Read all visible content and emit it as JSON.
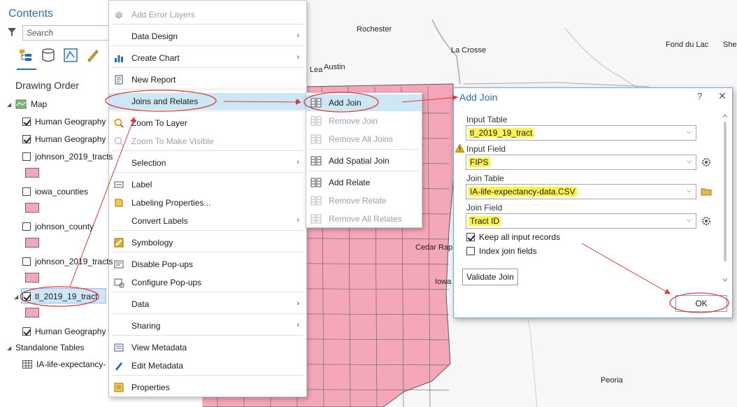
{
  "map": {
    "cities": [
      "Rochester",
      "La Crosse",
      "Fond du Lac",
      "She",
      "Austin",
      "Lea",
      "Cedar Rap",
      "Iowa",
      "Peoria"
    ],
    "county_fill": "#f4a7b9",
    "county_stroke": "#5a5a5a"
  },
  "contents": {
    "title": "Contents",
    "search_placeholder": "Search",
    "drawing_order_label": "Drawing Order",
    "map_label": "Map",
    "layers": [
      {
        "label": "Human Geography",
        "checked": true
      },
      {
        "label": "Human Geography",
        "checked": true
      },
      {
        "label": "johnson_2019_tracts",
        "checked": false
      },
      {
        "label": "iowa_counties",
        "checked": false
      },
      {
        "label": "johnson_county",
        "checked": false
      },
      {
        "label": "johnson_2019_tracts",
        "checked": false
      },
      {
        "label": "tl_2019_19_tract",
        "checked": true
      },
      {
        "label": "Human Geography",
        "checked": true
      }
    ],
    "standalone_label": "Standalone Tables",
    "table_label": "IA-life-expectancy-"
  },
  "context_menu": {
    "items": [
      {
        "label": "Add Error Layers",
        "disabled": true
      },
      {
        "label": "Data Design",
        "submenu": true
      },
      {
        "label": "Create Chart",
        "submenu": true
      },
      {
        "label": "New Report"
      },
      {
        "label": "Joins and Relates",
        "submenu": true
      },
      {
        "label": "Zoom To Layer"
      },
      {
        "label": "Zoom To Make Visible",
        "disabled": true
      },
      {
        "label": "Selection",
        "submenu": true
      },
      {
        "label": "Label"
      },
      {
        "label": "Labeling Properties..."
      },
      {
        "label": "Convert Labels",
        "submenu": true
      },
      {
        "label": "Symbology"
      },
      {
        "label": "Disable Pop-ups"
      },
      {
        "label": "Configure Pop-ups"
      },
      {
        "label": "Data",
        "submenu": true
      },
      {
        "label": "Sharing",
        "submenu": true
      },
      {
        "label": "View Metadata"
      },
      {
        "label": "Edit Metadata"
      },
      {
        "label": "Properties"
      }
    ]
  },
  "submenu": {
    "items": [
      {
        "label": "Add Join"
      },
      {
        "label": "Remove Join",
        "disabled": true
      },
      {
        "label": "Remove All Joins",
        "disabled": true
      },
      {
        "label": "Add Spatial Join"
      },
      {
        "label": "Add Relate"
      },
      {
        "label": "Remove Relate",
        "disabled": true
      },
      {
        "label": "Remove All Relates",
        "disabled": true
      }
    ]
  },
  "dialog": {
    "title": "Add Join",
    "help": "?",
    "close": "✕",
    "input_table_label": "Input Table",
    "input_table_value": "tl_2019_19_tract",
    "input_field_label": "Input Field",
    "input_field_value": "FIPS",
    "join_table_label": "Join Table",
    "join_table_value": "IA-life-expectancy-data.CSV",
    "join_field_label": "Join Field",
    "join_field_value": "Tract ID",
    "keep_all_label": "Keep all input records",
    "index_join_label": "Index join fields",
    "validate_label": "Validate Join",
    "ok_label": "OK"
  },
  "colors": {
    "accent": "#2b6cb0",
    "highlight": "#fff44f",
    "annotation": "#e53935",
    "menu_hover": "#cce8f6"
  }
}
